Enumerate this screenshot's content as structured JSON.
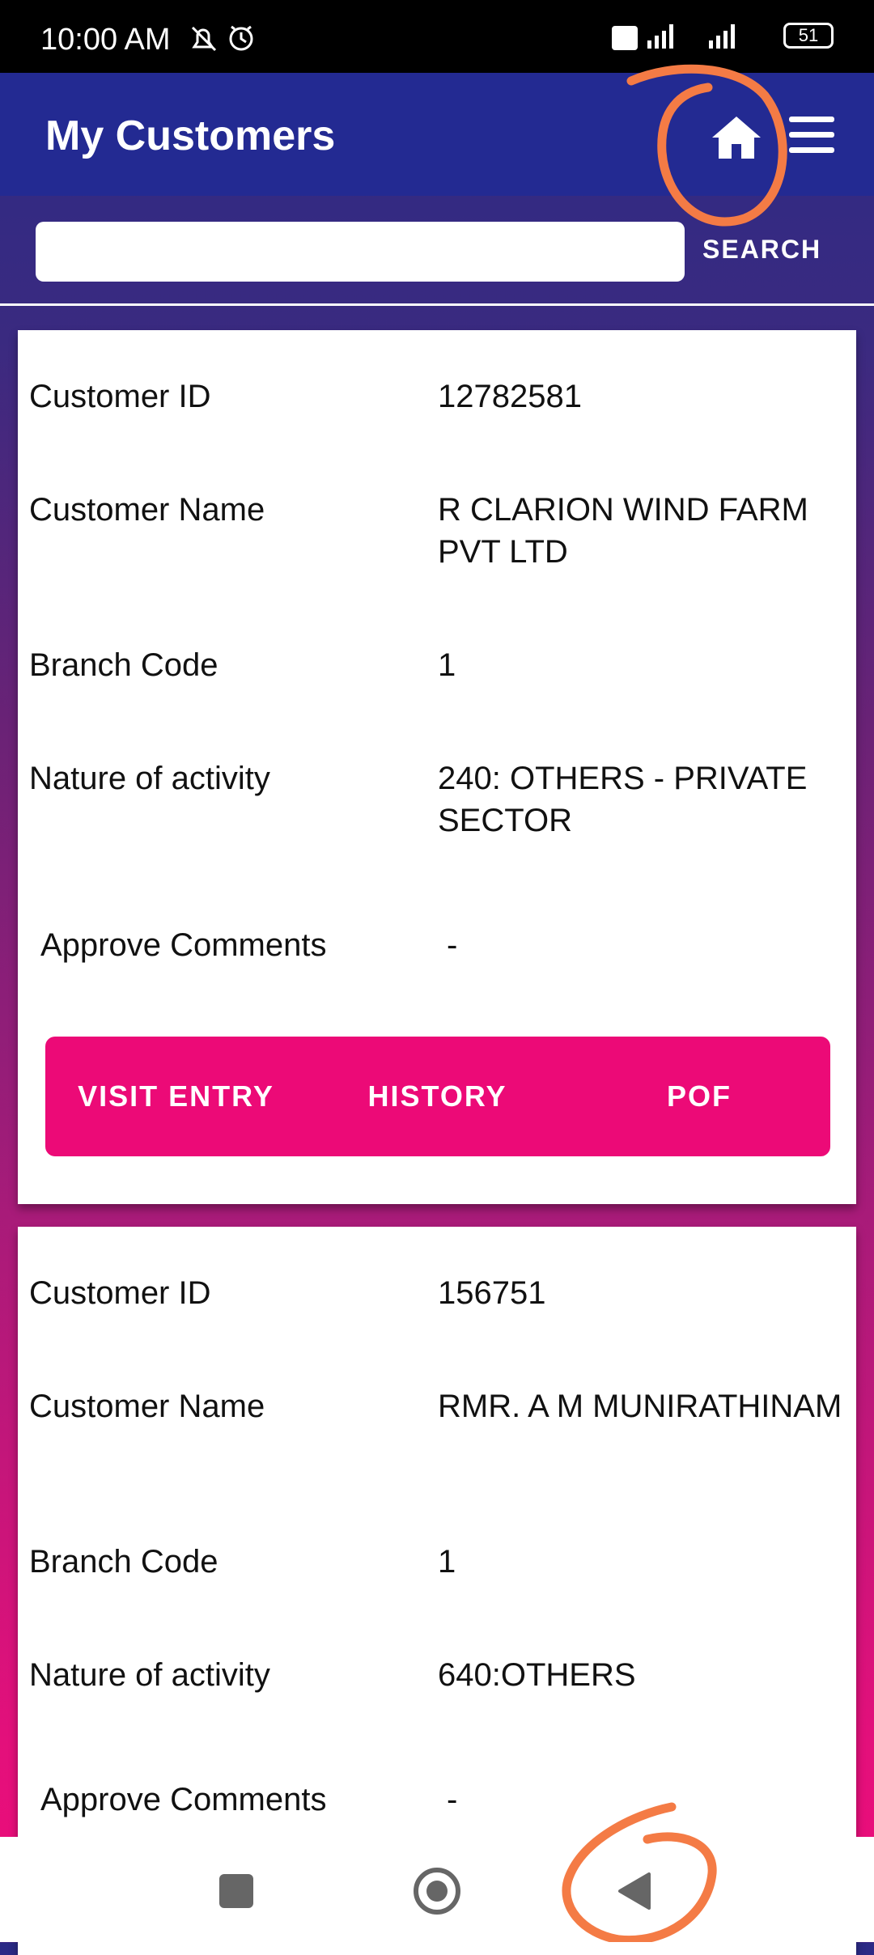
{
  "status_bar": {
    "time": "10:00 AM",
    "battery": "51"
  },
  "app_bar": {
    "title": "My Customers",
    "home_icon": "home-icon",
    "menu_icon": "hamburger-menu-icon"
  },
  "search": {
    "value": "",
    "placeholder": "",
    "button_label": "SEARCH"
  },
  "customers": [
    {
      "fields": [
        {
          "label": "Customer ID",
          "value": "12782581"
        },
        {
          "label": "Customer Name",
          "value": "R CLARION WIND FARM PVT LTD"
        },
        {
          "label": "Branch Code",
          "value": "1"
        },
        {
          "label": "Nature of activity",
          "value": "240: OTHERS - PRIVATE SECTOR"
        },
        {
          "label": "Approve Comments",
          "value": "-"
        }
      ],
      "actions": [
        "VISIT ENTRY",
        "HISTORY",
        "POF"
      ]
    },
    {
      "fields": [
        {
          "label": "Customer ID",
          "value": "156751"
        },
        {
          "label": "Customer Name",
          "value": "RMR. A M MUNIRATHINAM"
        },
        {
          "label": "Branch Code",
          "value": "1"
        },
        {
          "label": "Nature of activity",
          "value": "640:OTHERS"
        },
        {
          "label": "Approve Comments",
          "value": "-"
        }
      ]
    }
  ],
  "colors": {
    "app_bar": "#232a92",
    "action_bar": "#ec0a77",
    "annotation": "#f47b45"
  }
}
